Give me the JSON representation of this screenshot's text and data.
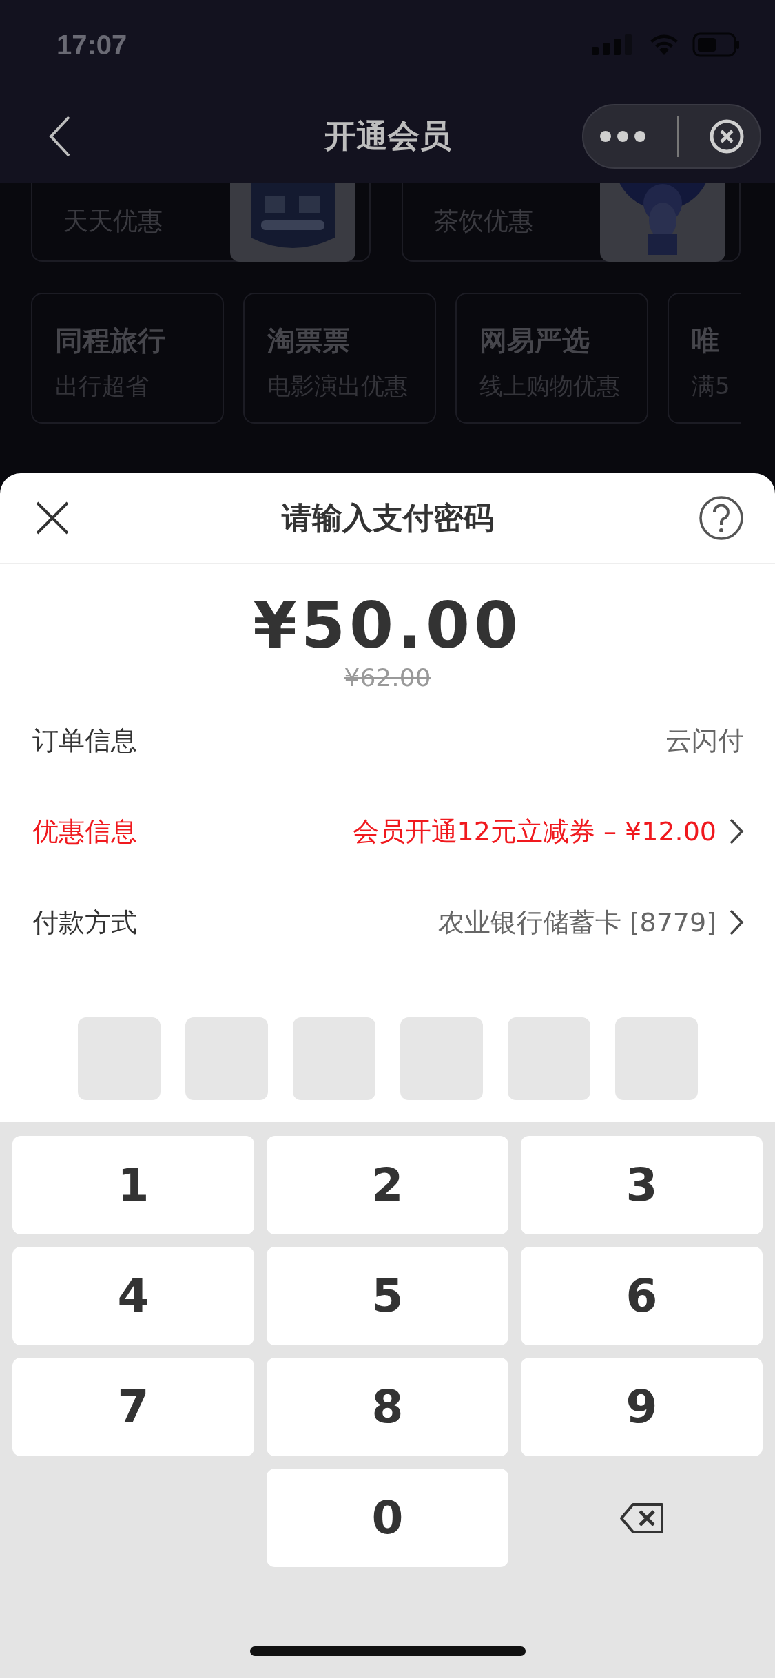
{
  "status_bar": {
    "time": "17:07"
  },
  "nav": {
    "title": "开通会员"
  },
  "background": {
    "top_cards": [
      {
        "subtitle": "天天优惠"
      },
      {
        "subtitle": "茶饮优惠"
      }
    ],
    "cards": [
      {
        "title": "同程旅行",
        "subtitle": "出行超省"
      },
      {
        "title": "淘票票",
        "subtitle": "电影演出优惠"
      },
      {
        "title": "网易严选",
        "subtitle": "线上购物优惠"
      },
      {
        "title": "唯",
        "subtitle": "满5"
      }
    ]
  },
  "payment_sheet": {
    "title": "请输入支付密码",
    "amount": "¥50.00",
    "original_amount": "¥62.00",
    "rows": [
      {
        "label": "订单信息",
        "value": "云闪付",
        "highlight": false,
        "chevron": false
      },
      {
        "label": "优惠信息",
        "value": "会员开通12元立减券 – ¥12.00",
        "highlight": true,
        "chevron": true
      },
      {
        "label": "付款方式",
        "value": "农业银行储蓄卡 [8779]",
        "highlight": false,
        "chevron": true
      }
    ],
    "pin_boxes": [
      {
        "filled": false
      },
      {
        "filled": false
      },
      {
        "filled": false
      },
      {
        "filled": false
      },
      {
        "filled": false
      },
      {
        "filled": false
      }
    ],
    "keypad": [
      {
        "kind": "digit",
        "label": "1"
      },
      {
        "kind": "digit",
        "label": "2"
      },
      {
        "kind": "digit",
        "label": "3"
      },
      {
        "kind": "digit",
        "label": "4"
      },
      {
        "kind": "digit",
        "label": "5"
      },
      {
        "kind": "digit",
        "label": "6"
      },
      {
        "kind": "digit",
        "label": "7"
      },
      {
        "kind": "digit",
        "label": "8"
      },
      {
        "kind": "digit",
        "label": "9"
      },
      {
        "kind": "blank"
      },
      {
        "kind": "digit",
        "label": "0"
      },
      {
        "kind": "backspace"
      }
    ]
  }
}
